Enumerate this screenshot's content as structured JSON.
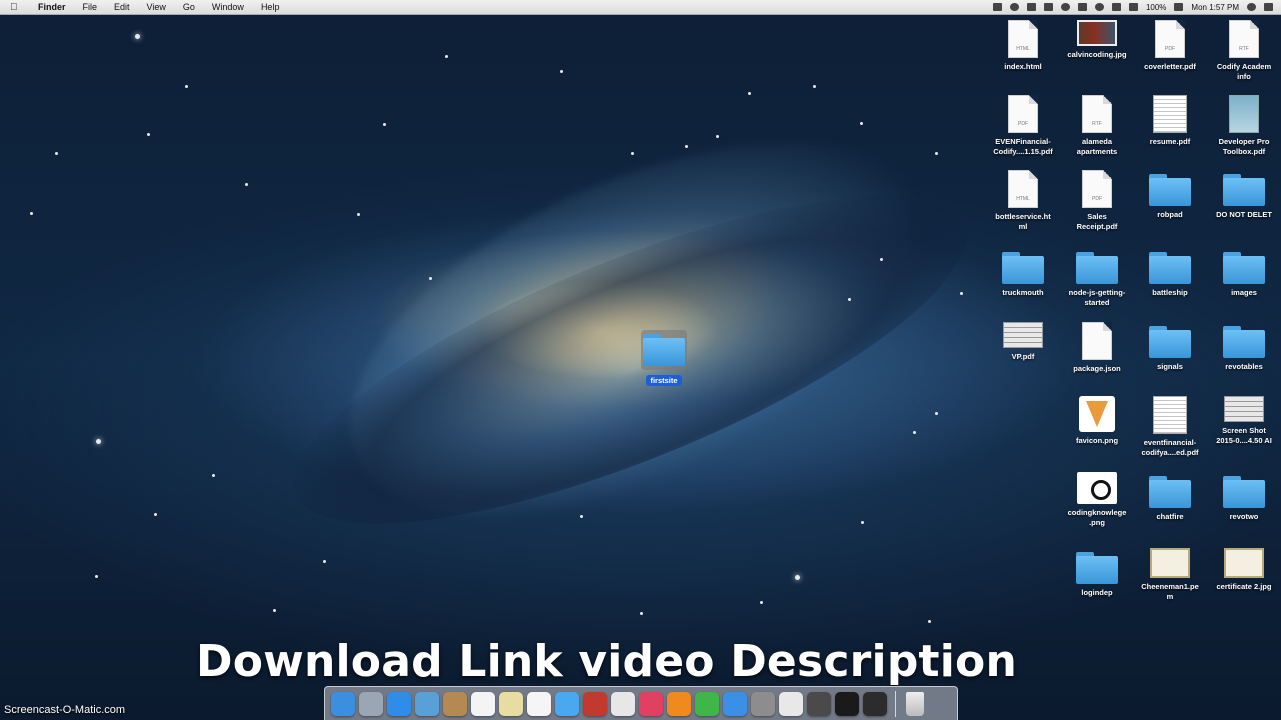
{
  "menubar": {
    "apple_icon": "apple-logo-icon",
    "app_name": "Finder",
    "menus": [
      "File",
      "Edit",
      "View",
      "Go",
      "Window",
      "Help"
    ],
    "battery": "100%",
    "clock": "Mon 1:57 PM"
  },
  "desktop": {
    "icons": [
      {
        "label": "index.html",
        "type": "html-doc",
        "badge": "HTML"
      },
      {
        "label": "calvincoding.jpg",
        "type": "image"
      },
      {
        "label": "coverletter.pdf",
        "type": "pdf-doc",
        "badge": "PDF"
      },
      {
        "label": "Codify Academ\ninfo",
        "type": "rtf-doc",
        "badge": "RTF"
      },
      {
        "label": "EVENFinancial-\nCodify....1.15.pdf",
        "type": "pdf-doc",
        "badge": "PDF"
      },
      {
        "label": "alameda\napartments",
        "type": "rtf-doc",
        "badge": "RTF"
      },
      {
        "label": "resume.pdf",
        "type": "pdf-page"
      },
      {
        "label": "Developer Pro\nToolbox.pdf",
        "type": "toolbox-doc"
      },
      {
        "label": "bottleservice.ht\nml",
        "type": "html-doc",
        "badge": "HTML"
      },
      {
        "label": "Sales\nReceipt.pdf",
        "type": "pdf-doc",
        "badge": "PDF"
      },
      {
        "label": "robpad",
        "type": "folder"
      },
      {
        "label": "DO NOT DELET",
        "type": "folder"
      },
      {
        "label": "truckmouth",
        "type": "folder"
      },
      {
        "label": "node-js-getting-\nstarted",
        "type": "folder"
      },
      {
        "label": "battleship",
        "type": "folder"
      },
      {
        "label": "images",
        "type": "folder"
      },
      {
        "label": "VP.pdf",
        "type": "screenshot"
      },
      {
        "label": "package.json",
        "type": "blank-doc"
      },
      {
        "label": "signals",
        "type": "folder"
      },
      {
        "label": "revotables",
        "type": "folder"
      },
      {
        "label": "favicon.png",
        "type": "pizza"
      },
      {
        "label": "eventfinancial-\ncodifya....ed.pdf",
        "type": "pdf-page"
      },
      {
        "label": "Screen Shot\n2015-0....4.50 AI",
        "type": "screenshot"
      },
      {
        "label": "codingknowlege\n.png",
        "type": "coding-image"
      },
      {
        "label": "chatfire",
        "type": "folder"
      },
      {
        "label": "revotwo",
        "type": "folder"
      },
      {
        "label": "logindep",
        "type": "folder"
      },
      {
        "label": "Cheeneman1.pe\nm",
        "type": "certificate"
      },
      {
        "label": "certificate 2.jpg",
        "type": "certificate"
      }
    ],
    "dragged_folder": {
      "label": "firstsite"
    }
  },
  "overlay": {
    "caption": "Download Link video Description",
    "watermark": "Screencast-O-Matic.com"
  },
  "dock": {
    "apps": [
      {
        "name": "finder-icon",
        "color": "#3b8fe0"
      },
      {
        "name": "launchpad-icon",
        "color": "#9aa6b4"
      },
      {
        "name": "safari-icon",
        "color": "#2f8ce8"
      },
      {
        "name": "mail-stamp-icon",
        "color": "#5aa0d8"
      },
      {
        "name": "contacts-icon",
        "color": "#b58a52"
      },
      {
        "name": "calendar-icon",
        "color": "#f4f4f4"
      },
      {
        "name": "notes-icon",
        "color": "#e9dca0"
      },
      {
        "name": "reminders-icon",
        "color": "#f5f5f5"
      },
      {
        "name": "messages-icon",
        "color": "#4aa8f0"
      },
      {
        "name": "photo-booth-icon",
        "color": "#c23a2f"
      },
      {
        "name": "photos-icon",
        "color": "#e7e7e7"
      },
      {
        "name": "itunes-icon",
        "color": "#e24062"
      },
      {
        "name": "ibooks-icon",
        "color": "#f08a1e"
      },
      {
        "name": "facetime-icon",
        "color": "#3fb54a"
      },
      {
        "name": "app-store-icon",
        "color": "#3a8fe6"
      },
      {
        "name": "system-preferences-icon",
        "color": "#8d8d8d"
      },
      {
        "name": "chrome-icon",
        "color": "#e8e8e8"
      },
      {
        "name": "sublime-text-icon",
        "color": "#4a4a4a"
      },
      {
        "name": "terminal-icon",
        "color": "#1a1a1a"
      },
      {
        "name": "sqm-icon",
        "color": "#2c2c2c"
      }
    ],
    "trash_icon": "trash-icon"
  }
}
